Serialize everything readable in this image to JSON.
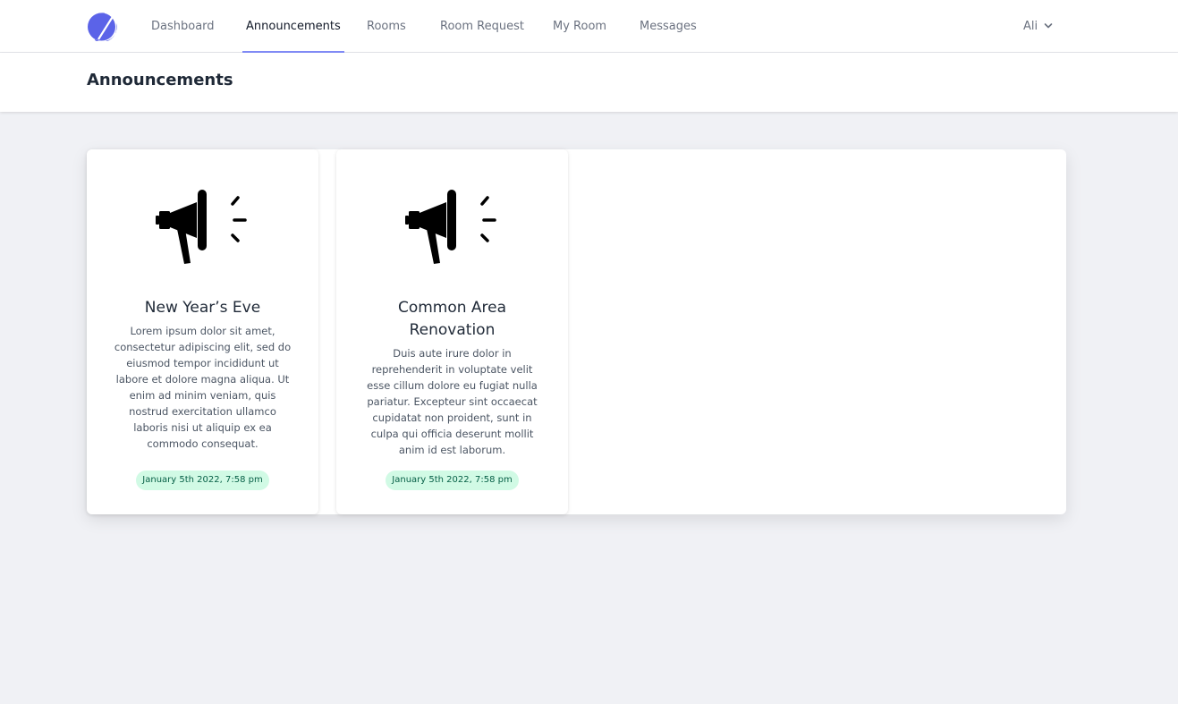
{
  "nav": {
    "items": [
      {
        "label": "Dashboard"
      },
      {
        "label": "Announcements"
      },
      {
        "label": "Rooms"
      },
      {
        "label": "Room Request"
      },
      {
        "label": "My Room"
      },
      {
        "label": "Messages"
      }
    ],
    "active_item": "Announcements",
    "user": {
      "name": "Ali"
    }
  },
  "page": {
    "title": "Announcements"
  },
  "announcements": [
    {
      "title": "New Year’s Eve",
      "body": "Lorem ipsum dolor sit amet, consectetur adipiscing elit, sed do eiusmod tempor incididunt ut labore et dolore magna aliqua. Ut enim ad minim veniam, quis nostrud exercitation ullamco laboris nisi ut aliquip ex ea commodo consequat.",
      "date": "January 5th 2022, 7:58 pm",
      "icon": "megaphone-icon"
    },
    {
      "title": "Common Area Renovation",
      "body": "Duis aute irure dolor in reprehenderit in voluptate velit esse cillum dolore eu fugiat nulla pariatur. Excepteur sint occaecat cupidatat non proident, sunt in culpa qui officia deserunt mollit anim id est laborum.",
      "date": "January 5th 2022, 7:58 pm",
      "icon": "megaphone-icon"
    }
  ],
  "colors": {
    "accent": "#818cf8",
    "logo": "#5b63e8",
    "badge_bg": "#d1fae5",
    "badge_text": "#065f46",
    "page_bg": "#f0f1f5"
  }
}
